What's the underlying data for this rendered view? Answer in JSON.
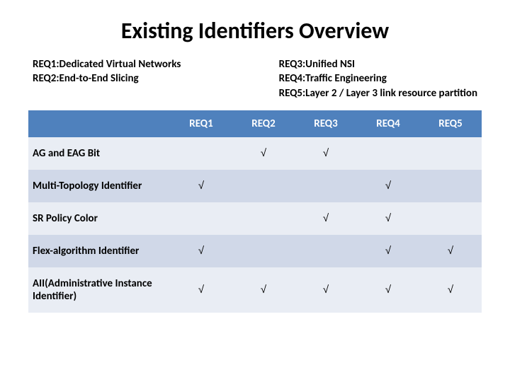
{
  "title": "Existing Identifiers Overview",
  "legend_left": [
    "REQ1:Dedicated Virtual Networks",
    "REQ2:End-to-End Slicing"
  ],
  "legend_right": [
    "REQ3:Unified NSI",
    "REQ4:Traffic Engineering",
    "REQ5:Layer 2 / Layer 3 link resource partition"
  ],
  "columns": [
    "REQ1",
    "REQ2",
    "REQ3",
    "REQ4",
    "REQ5"
  ],
  "check_mark": "√",
  "rows": [
    {
      "label": "AG and EAG Bit",
      "marks": [
        false,
        true,
        true,
        false,
        false
      ]
    },
    {
      "label": "Multi-Topology Identifier",
      "marks": [
        true,
        false,
        false,
        true,
        false
      ]
    },
    {
      "label": "SR Policy Color",
      "marks": [
        false,
        false,
        true,
        true,
        false
      ]
    },
    {
      "label": "Flex-algorithm Identifier",
      "marks": [
        true,
        false,
        false,
        true,
        true
      ]
    },
    {
      "label": "AII(Administrative Instance Identifier)",
      "marks": [
        true,
        true,
        true,
        true,
        true
      ]
    }
  ],
  "chart_data": {
    "type": "table",
    "title": "Existing Identifiers Overview",
    "columns": [
      "REQ1",
      "REQ2",
      "REQ3",
      "REQ4",
      "REQ5"
    ],
    "rows": [
      "AG and EAG Bit",
      "Multi-Topology Identifier",
      "SR Policy Color",
      "Flex-algorithm Identifier",
      "AII(Administrative Instance Identifier)"
    ],
    "matrix": [
      [
        0,
        1,
        1,
        0,
        0
      ],
      [
        1,
        0,
        0,
        1,
        0
      ],
      [
        0,
        0,
        1,
        1,
        0
      ],
      [
        1,
        0,
        0,
        1,
        1
      ],
      [
        1,
        1,
        1,
        1,
        1
      ]
    ]
  }
}
